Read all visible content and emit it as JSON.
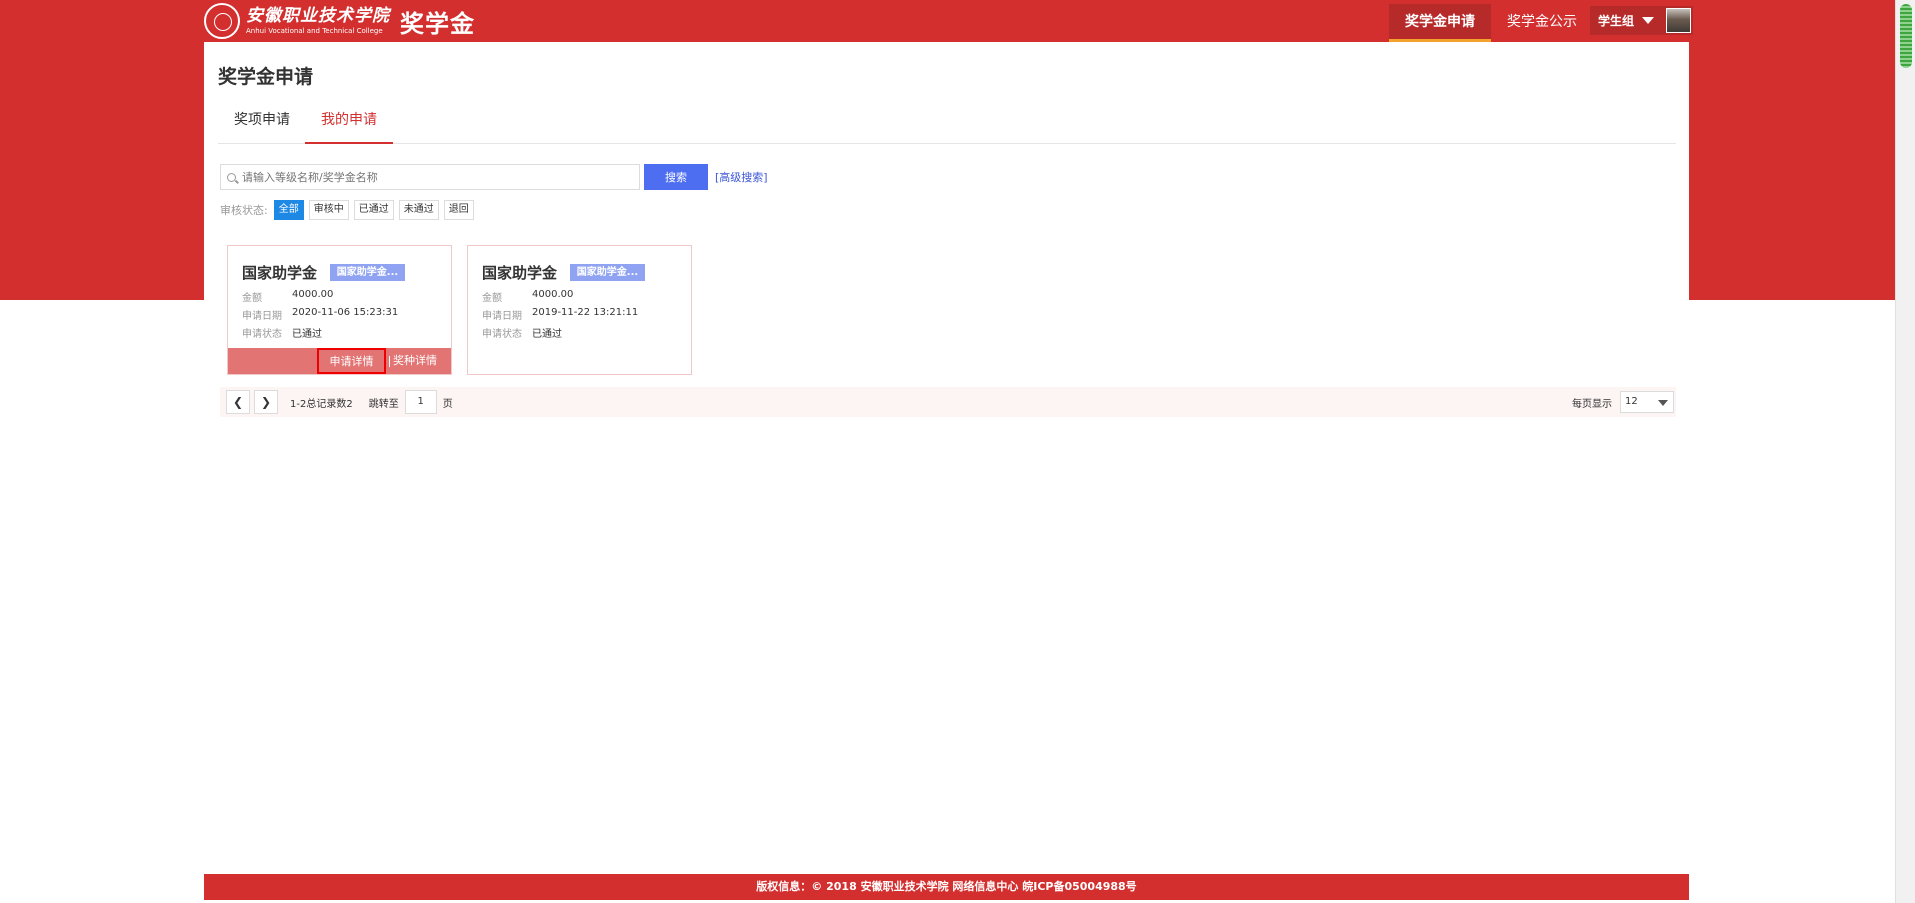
{
  "header": {
    "school_name": "安徽职业技术学院",
    "school_name_en": "Anhui Vocational and Technical College",
    "system_name": "奖学金",
    "nav": [
      {
        "label": "奖学金申请",
        "active": true
      },
      {
        "label": "奖学金公示",
        "active": false
      }
    ],
    "user": {
      "role": "学生组"
    }
  },
  "main": {
    "title": "奖学金申请",
    "tabs": [
      {
        "label": "奖项申请",
        "active": false
      },
      {
        "label": "我的申请",
        "active": true
      }
    ],
    "search": {
      "placeholder": "请输入等级名称/奖学金名称",
      "button": "搜索",
      "advanced": "[高级搜索]"
    },
    "filter": {
      "label": "审核状态:",
      "options": [
        "全部",
        "审核中",
        "已通过",
        "未通过",
        "退回"
      ],
      "selected": "全部"
    },
    "cards": [
      {
        "name": "国家助学金",
        "badge": "国家助学金...",
        "amount_label": "金额",
        "amount": "4000.00",
        "date_label": "申请日期",
        "date": "2020-11-06 15:23:31",
        "status_label": "申请状态",
        "status": "已通过",
        "btn_detail": "申请详情",
        "btn_type": "奖种详情"
      },
      {
        "name": "国家助学金",
        "badge": "国家助学金...",
        "amount_label": "金额",
        "amount": "4000.00",
        "date_label": "申请日期",
        "date": "2019-11-22 13:21:11",
        "status_label": "申请状态",
        "status": "已通过"
      }
    ],
    "pager": {
      "total": "1-2总记录数2",
      "jump_label": "跳转至",
      "page": "1",
      "page_unit": "页",
      "per_page_label": "每页显示",
      "per_page": "12"
    }
  },
  "footer": {
    "text": "版权信息：© 2018 安徽职业技术学院 网络信息中心 皖ICP备05004988号"
  },
  "colors": {
    "brand": "#d32f2f",
    "accent": "#4e6ef2",
    "active_filter": "#1e88e5"
  }
}
